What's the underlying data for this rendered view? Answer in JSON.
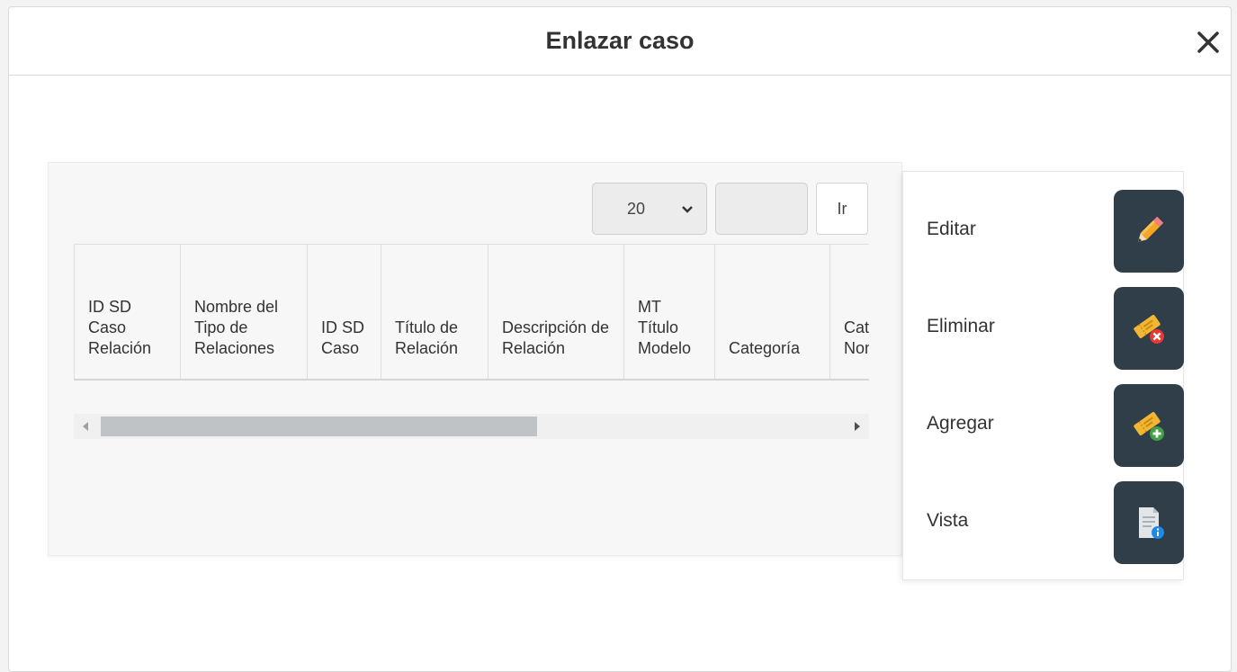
{
  "modal": {
    "title": "Enlazar caso",
    "close_icon": "close-icon"
  },
  "pagination": {
    "page_size": "20",
    "page_input_value": "",
    "go_label": "Ir"
  },
  "table": {
    "columns": [
      "ID SD Caso Relación",
      "Nombre del Tipo de Relaciones",
      "ID SD Caso",
      "Título de Relación",
      "Descripción de Relación",
      "MT Título Modelo",
      "Categoría",
      "Categoría Nombre"
    ],
    "rows": []
  },
  "actions": [
    {
      "label": "Editar",
      "icon": "pencil-icon"
    },
    {
      "label": "Eliminar",
      "icon": "ticket-delete-icon"
    },
    {
      "label": "Agregar",
      "icon": "ticket-add-icon"
    },
    {
      "label": "Vista",
      "icon": "document-info-icon"
    }
  ],
  "colors": {
    "action_button_bg": "#2f3e48",
    "pencil": "#f5a623",
    "ticket": "#f2b632",
    "delete_badge": "#e53935",
    "add_badge": "#43a047",
    "info_badge": "#1e88e5"
  }
}
